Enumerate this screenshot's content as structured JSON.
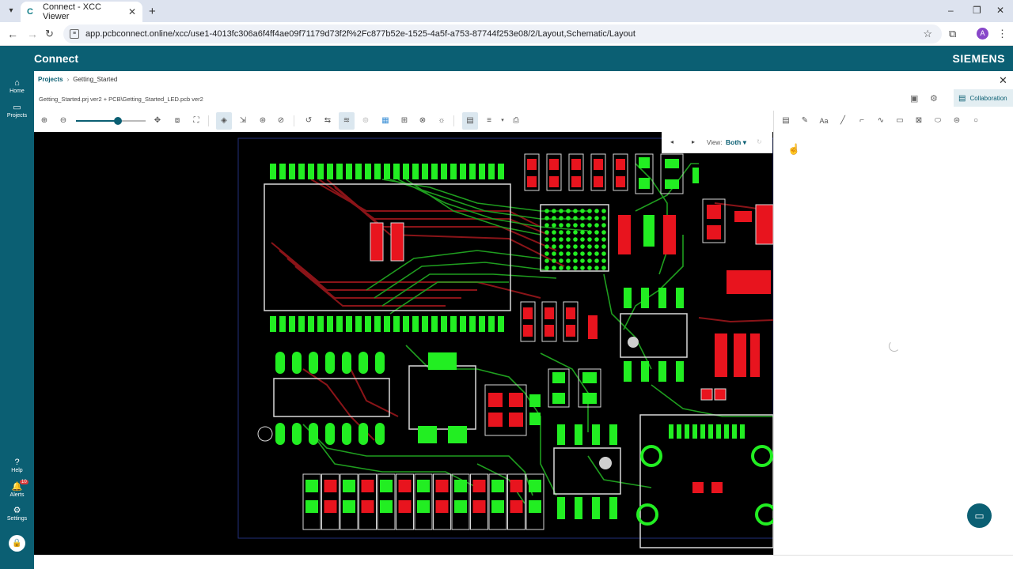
{
  "browser": {
    "tab_title": "Connect - XCC Viewer",
    "tab_favicon": "C",
    "url": "app.pcbconnect.online/xcc/use1-4013fc306a6f4ff4ae09f71179d73f2f%2Fc877b52e-1525-4a5f-a753-87744f253e08/2/Layout,Schematic/Layout",
    "profile_initial": "A"
  },
  "app": {
    "brand": "Connect",
    "vendor": "SIEMENS",
    "accent": "#0b5f73"
  },
  "rail": {
    "items": [
      {
        "label": "Home",
        "icon": "home-icon"
      },
      {
        "label": "Projects",
        "icon": "folder-icon"
      },
      {
        "label": "Help",
        "icon": "help-icon"
      },
      {
        "label": "Alerts",
        "icon": "bell-icon",
        "badge": "10"
      },
      {
        "label": "Settings",
        "icon": "gear-icon"
      }
    ]
  },
  "breadcrumb": {
    "root": "Projects",
    "current": "Getting_Started"
  },
  "file_path": "Getting_Started.prj ver2 + PCB\\Getting_Started_LED.pcb ver2",
  "collaboration_label": "Collaboration",
  "zoom_slider": {
    "value": 0.6
  },
  "view": {
    "label": "View:",
    "value": "Both"
  },
  "colors": {
    "board_bg": "#000000",
    "top_copper": "#22ee22",
    "bottom_copper": "#e8141e",
    "trace_top": "#1f9e1f",
    "trace_bottom": "#8a1418",
    "silk": "#d9d9d9"
  }
}
